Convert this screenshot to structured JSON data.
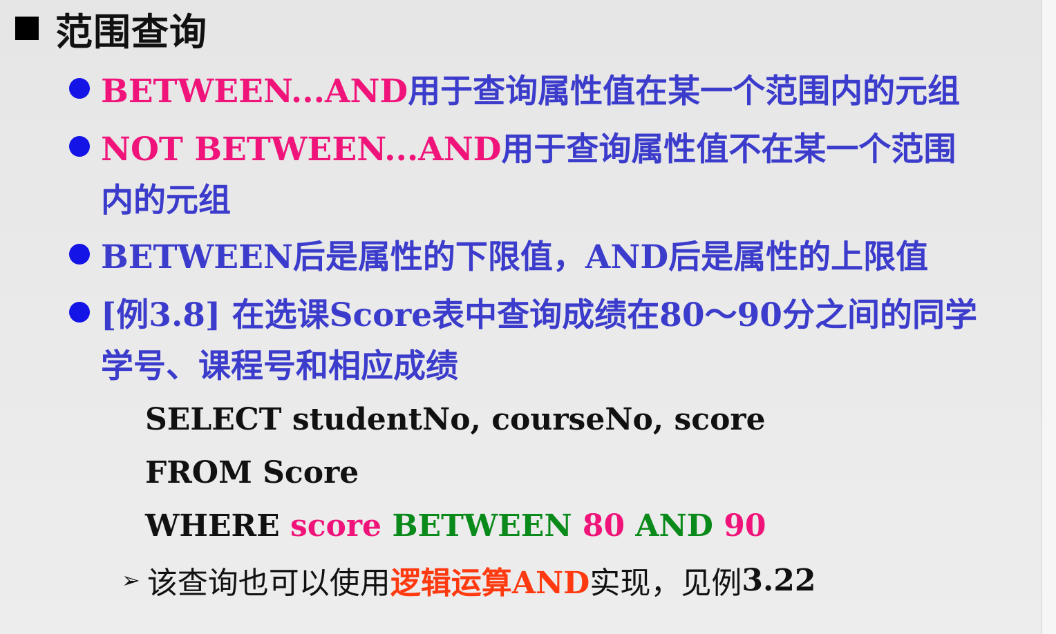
{
  "heading": {
    "text": "范围查询"
  },
  "bullets": [
    {
      "keyword": "BETWEEN...AND",
      "text": "用于查询属性值在某一个范围内的元组"
    },
    {
      "keyword": "NOT BETWEEN...AND",
      "text_line1": "用于查询属性值不在某一个范围",
      "text_line2": "内的元组"
    },
    {
      "text": "BETWEEN后是属性的下限值，AND后是属性的上限值"
    },
    {
      "text_line1": "[例3.8] 在选课Score表中查询成绩在80～90分之间的同学",
      "text_line2": "学号、课程号和相应成绩"
    }
  ],
  "code": {
    "line1": "SELECT studentNo, courseNo, score",
    "line2": "FROM Score",
    "line3": {
      "where": "WHERE ",
      "col": "score",
      "between": " BETWEEN ",
      "low": "80",
      "and": " AND ",
      "high": "90"
    }
  },
  "note": {
    "prefix": "该查询也可以使用",
    "highlight": "逻辑运算AND",
    "middle": "实现，见例",
    "ref": "3.22"
  },
  "colors": {
    "bullet_blue": "#1414e6",
    "text_blue": "#3c3ccc",
    "keyword_pink": "#f0147a",
    "sql_green": "#0a8a1a",
    "note_orange": "#ff3a10"
  },
  "icons": {
    "heading_bullet": "black-square-icon",
    "item_bullet": "blue-dot-icon",
    "note_bullet": "arrowhead-icon"
  }
}
